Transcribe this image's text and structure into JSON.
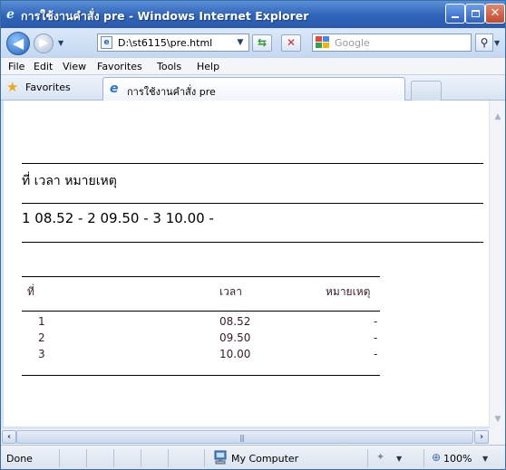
{
  "window": {
    "title": "การใช้งานคำสั่ง pre - Windows Internet Explorer"
  },
  "address_bar": {
    "url": "D:\\st6115\\pre.html",
    "search_placeholder": "Google"
  },
  "menu": {
    "items": [
      "File",
      "Edit",
      "View",
      "Favorites",
      "Tools",
      "Help"
    ]
  },
  "favorites_bar": {
    "favorites_label": "Favorites",
    "tab_title": "การใช้งานคำสั่ง pre"
  },
  "page": {
    "heading_line": "ที่ เวลา หมายเหตุ",
    "collapsed_line": "1 08.52 - 2 09.50 - 3 10.00 -",
    "table": {
      "headers": [
        "ที่",
        "เวลา",
        "หมายเหตุ"
      ],
      "rows": [
        [
          "1",
          "08.52",
          "-"
        ],
        [
          "2",
          "09.50",
          "-"
        ],
        [
          "3",
          "10.00",
          "-"
        ]
      ]
    }
  },
  "status_bar": {
    "status": "Done",
    "zone": "My Computer",
    "zoom": "100%"
  }
}
